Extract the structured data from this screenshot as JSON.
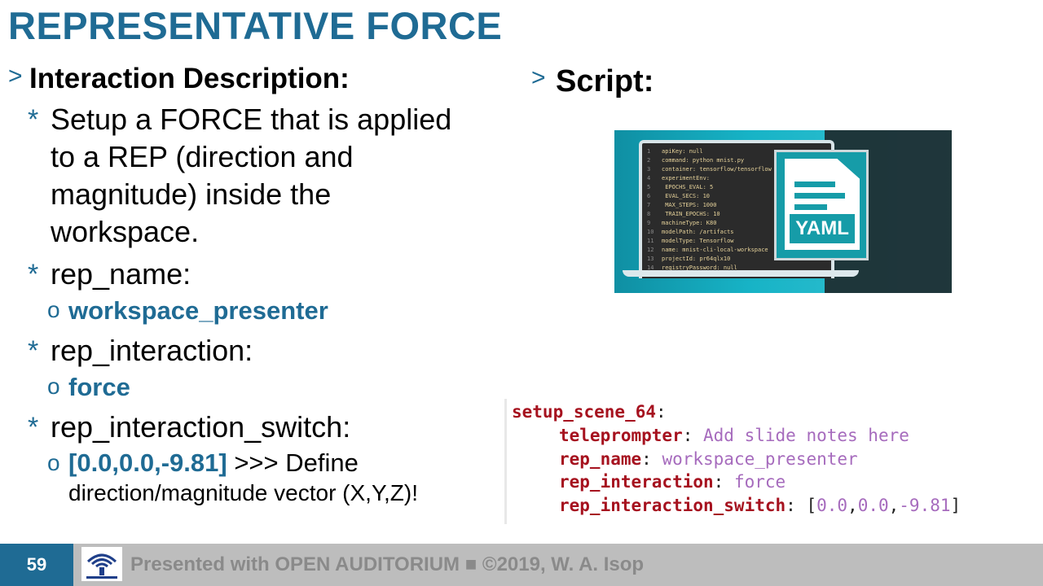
{
  "title": "REPRESENTATIVE FORCE",
  "left": {
    "heading_arrow": ">",
    "heading": "Interaction Description:",
    "bullet_marker": "*",
    "sub_marker": "o",
    "b1_lines": [
      "Setup a FORCE that is applied",
      "to a REP (direction and",
      "magnitude) inside the",
      "workspace."
    ],
    "b2": "rep_name:",
    "b2_sub": "workspace_presenter",
    "b3": "rep_interaction:",
    "b3_sub": "force",
    "b4": "rep_interaction_switch:",
    "b4_sub_value": "[0.0,0.0,-9.81]",
    "b4_sub_rest1": " >>> Define",
    "b4_sub_rest2": "direction/magnitude vector (X,Y,Z)!"
  },
  "right": {
    "heading_arrow": ">",
    "heading": "Script:",
    "image_label": "YAML",
    "image_code": [
      {
        "n": "1",
        "t": "apiKey: null"
      },
      {
        "n": "2",
        "t": "command: python mnist.py"
      },
      {
        "n": "3",
        "t": "container: tensorflow/tensorflow"
      },
      {
        "n": "4",
        "t": "experimentEnv:"
      },
      {
        "n": "5",
        "t": "  EPOCHS_EVAL: 5"
      },
      {
        "n": "6",
        "t": "  EVAL_SECS: 10"
      },
      {
        "n": "7",
        "t": "  MAX_STEPS: 1000"
      },
      {
        "n": "8",
        "t": "  TRAIN_EPOCHS: 10"
      },
      {
        "n": "9",
        "t": "machineType: K80"
      },
      {
        "n": "10",
        "t": "modelPath: /artifacts"
      },
      {
        "n": "11",
        "t": "modelType: Tensorflow"
      },
      {
        "n": "12",
        "t": "name: mnist-cli-local-workspace"
      },
      {
        "n": "13",
        "t": "projectId: pr64qlx10"
      },
      {
        "n": "14",
        "t": "registryPassword: null"
      }
    ]
  },
  "script": {
    "root_key": "setup_scene_64",
    "teleprompter_key": "teleprompter",
    "teleprompter_val": "Add slide notes here",
    "rep_name_key": "rep_name",
    "rep_name_val": "workspace_presenter",
    "rep_interaction_key": "rep_interaction",
    "rep_interaction_val": "force",
    "switch_key": "rep_interaction_switch",
    "switch_v1": "0.0",
    "switch_v2": "0.0",
    "switch_v3": "-9.81"
  },
  "footer": {
    "page_number": "59",
    "text": "Presented with OPEN AUDITORIUM ■ ©2019, W. A. Isop"
  }
}
